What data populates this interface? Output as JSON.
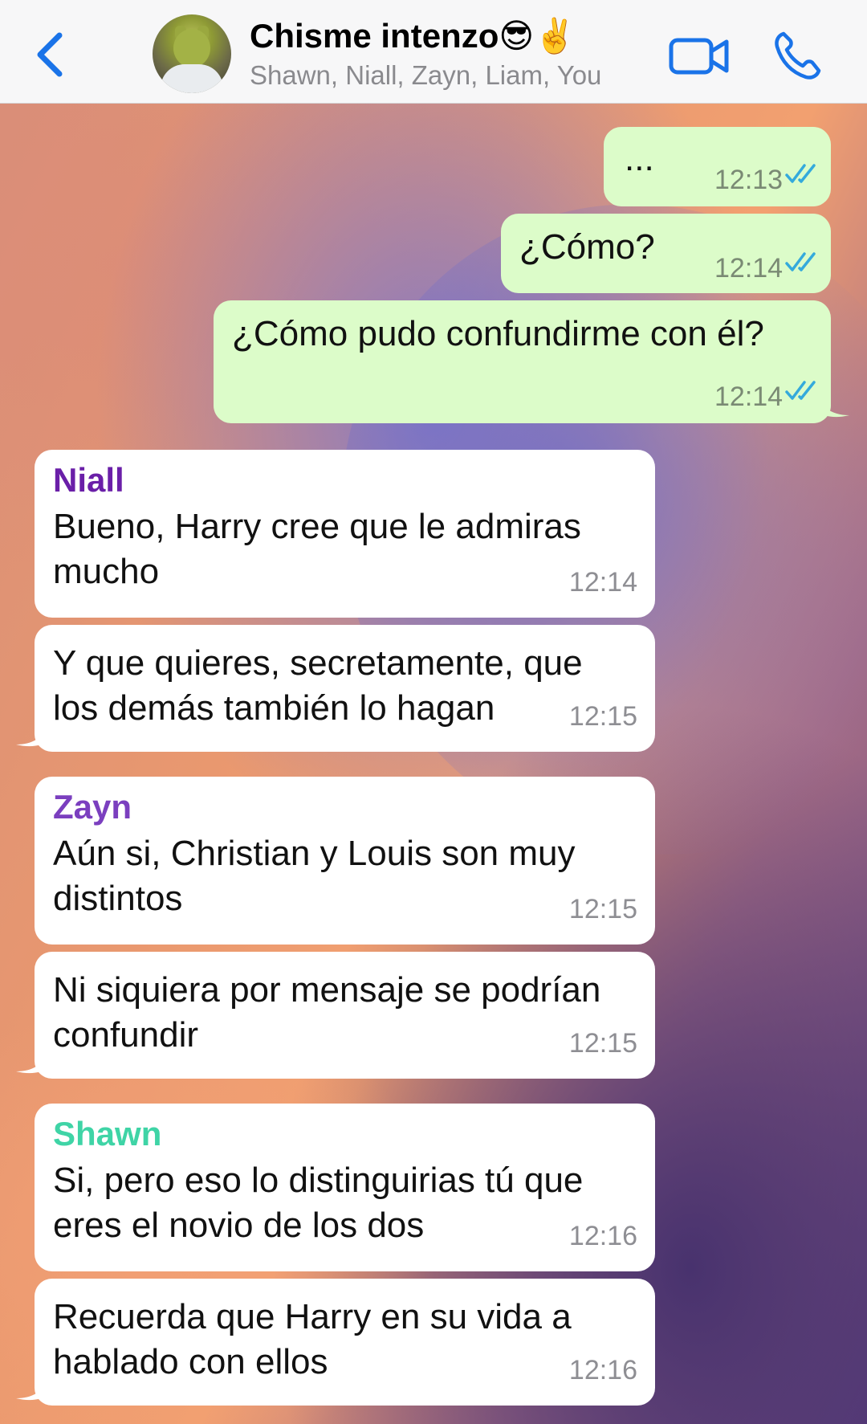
{
  "header": {
    "title": "Chisme intenzo😎✌️",
    "subtitle": "Shawn, Niall, Zayn, Liam, You",
    "icons": [
      "back-chevron-icon",
      "group-avatar",
      "video-call-icon",
      "voice-call-icon"
    ]
  },
  "colors": {
    "outgoing_bubble": "#dcfcc9",
    "incoming_bubble": "#ffffff",
    "accent": "#1a73e8",
    "read_ticks": "#34aadc",
    "niall": "#6a1fa8",
    "zayn": "#7b3fbf",
    "shawn": "#3fd4a6"
  },
  "messages": [
    {
      "direction": "out",
      "text": "...",
      "time": "12:13"
    },
    {
      "direction": "out",
      "text": "¿Cómo?",
      "time": "12:14"
    },
    {
      "direction": "out",
      "text": "¿Cómo pudo confundirme con él?",
      "time": "12:14"
    },
    {
      "direction": "in",
      "sender": "Niall",
      "text": "Bueno, Harry cree que le admiras mucho",
      "time": "12:14"
    },
    {
      "direction": "in",
      "text": "Y que quieres, secretamente, que los demás también lo hagan",
      "time": "12:15"
    },
    {
      "direction": "in",
      "sender": "Zayn",
      "text": "Aún si, Christian y Louis son muy distintos",
      "time": "12:15"
    },
    {
      "direction": "in",
      "text": "Ni siquiera por mensaje se podrían confundir",
      "time": "12:15"
    },
    {
      "direction": "in",
      "sender": "Shawn",
      "text": "Si, pero eso lo distinguirias tú que eres el novio de los dos",
      "time": "12:16"
    },
    {
      "direction": "in",
      "text": "Recuerda que Harry en su vida a hablado con ellos",
      "time": "12:16"
    }
  ]
}
